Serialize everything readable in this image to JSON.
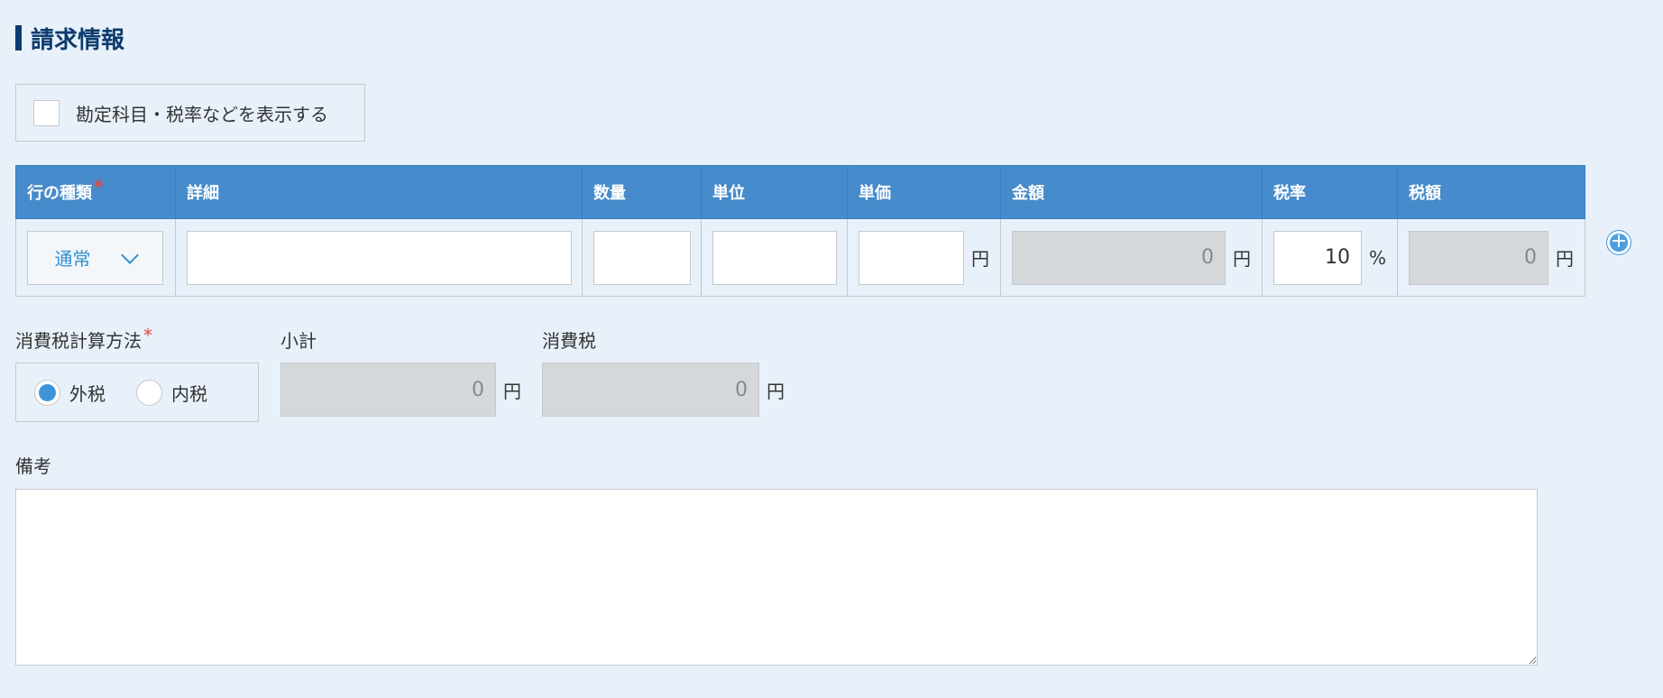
{
  "section": {
    "title": "請求情報"
  },
  "toggle": {
    "label": "勘定科目・税率などを表示する",
    "checked": false
  },
  "table": {
    "headers": [
      "行の種類",
      "詳細",
      "数量",
      "単位",
      "単価",
      "金額",
      "税率",
      "税額"
    ],
    "required_marker": "*",
    "row": {
      "type": "通常",
      "detail": "",
      "quantity": "",
      "unit": "",
      "unit_price": "",
      "unit_price_suffix": "円",
      "amount": "0",
      "amount_suffix": "円",
      "tax_rate": "10",
      "tax_rate_suffix": "%",
      "tax_amount": "0",
      "tax_amount_suffix": "円"
    },
    "add_button": "+"
  },
  "tax_method": {
    "label": "消費税計算方法",
    "required_marker": "*",
    "options": [
      {
        "label": "外税",
        "selected": true
      },
      {
        "label": "内税",
        "selected": false
      }
    ]
  },
  "subtotal": {
    "label": "小計",
    "value": "0",
    "suffix": "円"
  },
  "consumption_tax": {
    "label": "消費税",
    "value": "0",
    "suffix": "円"
  },
  "remarks": {
    "label": "備考",
    "value": ""
  },
  "colors": {
    "header": "#468bcb",
    "accent": "#3d95d9",
    "required": "#e5473b",
    "title": "#0d3b6e"
  }
}
